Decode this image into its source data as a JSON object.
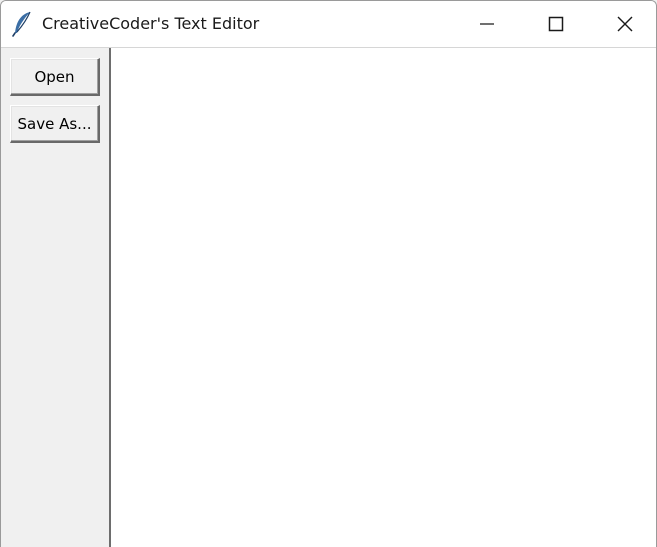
{
  "window": {
    "title": "CreativeCoder's Text Editor",
    "controls": {
      "minimize_icon": "minimize-icon",
      "maximize_icon": "maximize-icon",
      "close_icon": "close-icon"
    }
  },
  "toolbar": {
    "open_label": "Open",
    "save_as_label": "Save As..."
  },
  "editor": {
    "content": ""
  },
  "colors": {
    "titlebar_bg": "#ffffff",
    "window_bg": "#f0f0f0",
    "editor_bg": "#ffffff",
    "icon_blue": "#3b6ea5"
  }
}
